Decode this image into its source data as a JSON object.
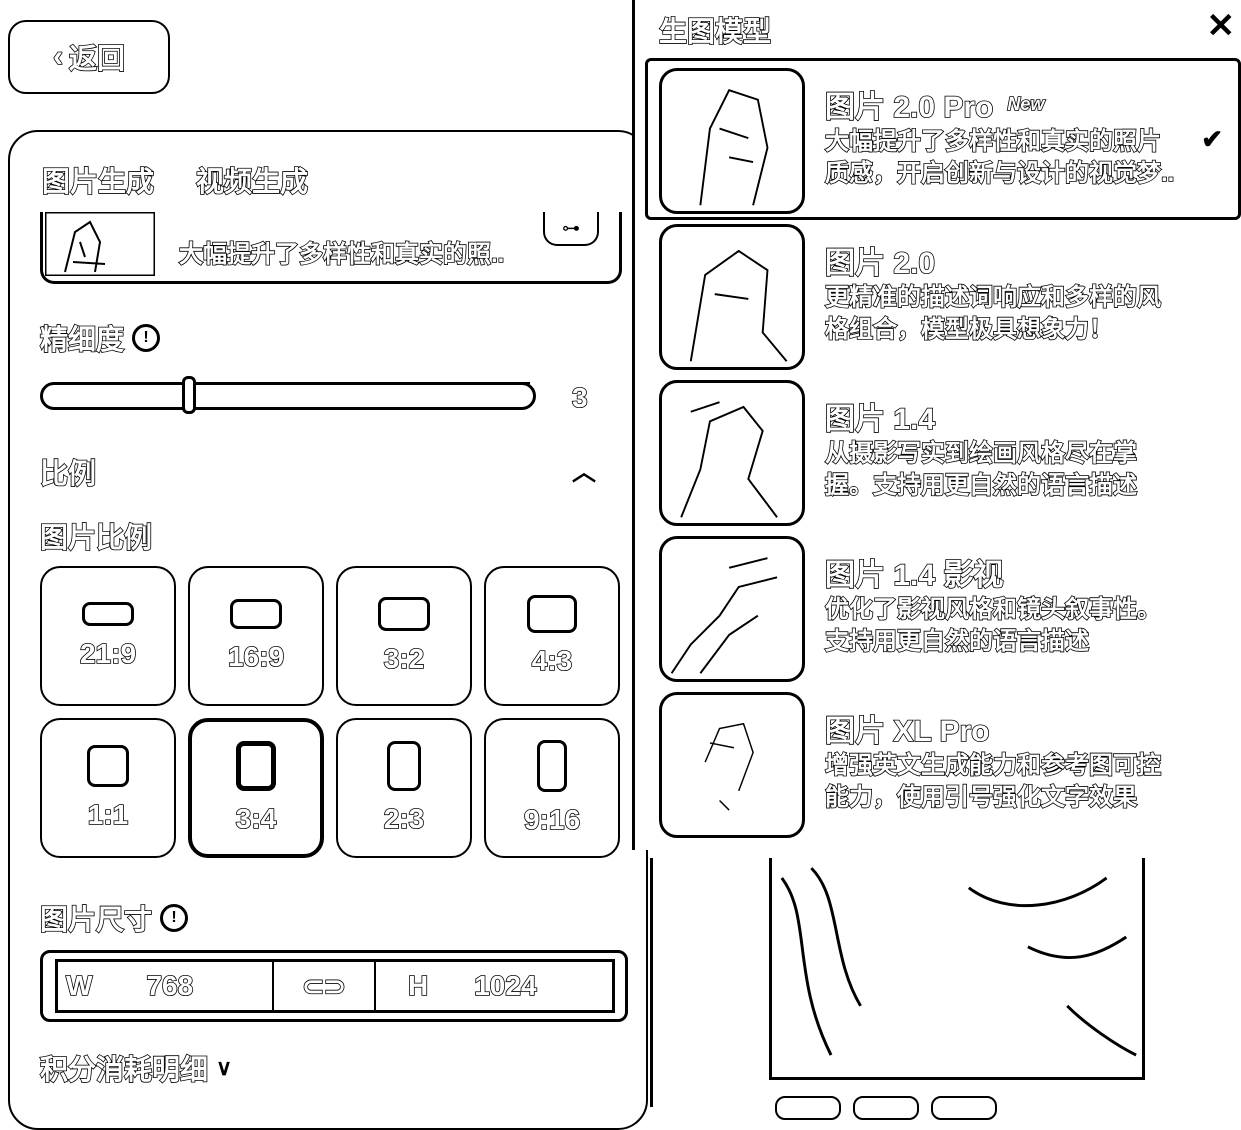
{
  "back_button": {
    "label": "返回"
  },
  "tabs": [
    {
      "label": "图片生成"
    },
    {
      "label": "视频生成"
    }
  ],
  "current_model": {
    "description": "大幅提升了多样性和真实的照.."
  },
  "detail": {
    "label": "精细度",
    "value": "3",
    "level_fraction": 0.3
  },
  "ratio_section": {
    "label": "比例",
    "image_ratio_label": "图片比例"
  },
  "ratios": [
    {
      "label": "21:9",
      "selected": false
    },
    {
      "label": "16:9",
      "selected": false
    },
    {
      "label": "3:2",
      "selected": false
    },
    {
      "label": "4:3",
      "selected": false
    },
    {
      "label": "1:1",
      "selected": false
    },
    {
      "label": "3:4",
      "selected": true
    },
    {
      "label": "2:3",
      "selected": false
    },
    {
      "label": "9:16",
      "selected": false
    }
  ],
  "size": {
    "label": "图片尺寸",
    "w_label": "W",
    "w_value": "768",
    "h_label": "H",
    "h_value": "1024"
  },
  "points_detail": {
    "label": "积分消耗明细"
  },
  "drawer": {
    "title": "生图模型",
    "models": [
      {
        "name": "图片 2.0 Pro",
        "badge": "New",
        "desc": "大幅提升了多样性和真实的照片质感，开启创新与设计的视觉梦..",
        "selected": true
      },
      {
        "name": "图片 2.0",
        "badge": "",
        "desc": "更精准的描述词响应和多样的风格组合，模型极具想象力！",
        "selected": false
      },
      {
        "name": "图片 1.4",
        "badge": "",
        "desc": "从摄影写实到绘画风格尽在掌握。支持用更自然的语言描述",
        "selected": false
      },
      {
        "name": "图片 1.4 影视",
        "badge": "",
        "desc": "优化了影视风格和镜头叙事性。支持用更自然的语言描述",
        "selected": false
      },
      {
        "name": "图片 XL Pro",
        "badge": "",
        "desc": "增强英文生成能力和参考图可控能力，使用引号强化文字效果",
        "selected": false
      }
    ]
  }
}
